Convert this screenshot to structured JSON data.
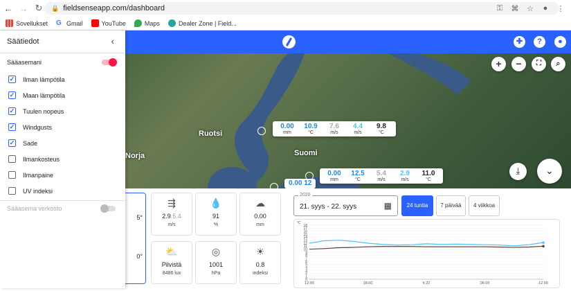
{
  "browser": {
    "url": "fieldsenseapp.com/dashboard",
    "bookmarks": [
      "Sovellukset",
      "Gmail",
      "YouTube",
      "Maps",
      "Dealer Zone | Field..."
    ]
  },
  "colors": {
    "accent": "#2962ff",
    "toggle_on": "#ff1744",
    "temp": "#4fc3f7"
  },
  "sidebar": {
    "title": "Säätiedot",
    "stations_label": "Sääasemani",
    "stations_toggle": true,
    "items": [
      {
        "label": "Ilman lämpötila",
        "checked": true
      },
      {
        "label": "Maan lämpötila",
        "checked": true
      },
      {
        "label": "Tuulen nopeus",
        "checked": true
      },
      {
        "label": "Windgusts",
        "checked": true
      },
      {
        "label": "Sade",
        "checked": true
      },
      {
        "label": "Ilmankosteus",
        "checked": false
      },
      {
        "label": "Ilmanpaine",
        "checked": false
      },
      {
        "label": "UV indeksi",
        "checked": false
      }
    ],
    "network_label": "Sääasema verkosto",
    "network_toggle": false
  },
  "map": {
    "labels": [
      "Ruotsi",
      "Suomi",
      "Norja"
    ],
    "popups": [
      {
        "values": [
          {
            "v": "0.00",
            "u": "mm",
            "c": "#1e88e5"
          },
          {
            "v": "10.9",
            "u": "°C",
            "c": "#1e88e5"
          },
          {
            "v": "7.6",
            "u": "m/s",
            "c": "#aaaaaa"
          },
          {
            "v": "4.4",
            "u": "m/s",
            "c": "#4fc3f7"
          },
          {
            "v": "9.8",
            "u": "°C",
            "c": "#222222"
          }
        ]
      },
      {
        "values": [
          {
            "v": "0.00",
            "u": "mm",
            "c": "#1e88e5"
          },
          {
            "v": "12.5",
            "u": "°C",
            "c": "#1e88e5"
          },
          {
            "v": "5.4",
            "u": "m/s",
            "c": "#aaaaaa"
          },
          {
            "v": "2.9",
            "u": "m/s",
            "c": "#4fc3f7"
          },
          {
            "v": "11.0",
            "u": "°C",
            "c": "#222222"
          }
        ]
      }
    ],
    "partial_popup": "0.00  12"
  },
  "tiles_row1": [
    {
      "icon": "wind-icon",
      "glyph": "⇶",
      "value": "2.9",
      "alt": "5.4",
      "unit": "m/s"
    },
    {
      "icon": "humidity-icon",
      "glyph": "💧",
      "value": "91",
      "alt": "",
      "unit": "%"
    },
    {
      "icon": "rain-cloud-icon",
      "glyph": "☁",
      "value": "0.00",
      "alt": "",
      "unit": "mm"
    }
  ],
  "tiles_row2": [
    {
      "icon": "partly-cloudy-icon",
      "glyph": "⛅",
      "value": "Pilvistä",
      "alt": "",
      "unit": "8486 lux"
    },
    {
      "icon": "pressure-gauge-icon",
      "glyph": "◎",
      "value": "1001",
      "alt": "",
      "unit": "hPa"
    },
    {
      "icon": "sun-icon",
      "glyph": "☀",
      "value": "0.8",
      "alt": "",
      "unit": "indeksi"
    }
  ],
  "partial_tile": {
    "t1": "5°",
    "t2": "0°"
  },
  "range": {
    "year": "2020",
    "dates": "21. syys - 22. syys",
    "buttons": [
      "24 tuntia",
      "7 päivää",
      "4 viikkoa"
    ],
    "active": 0
  },
  "chart_data": {
    "type": "line",
    "ylabel": "°C",
    "ylim": [
      0,
      18
    ],
    "yticks": [
      0,
      1,
      2,
      3,
      4,
      5,
      6,
      7,
      8,
      9,
      10,
      11,
      12,
      13,
      14,
      15,
      16,
      17,
      18
    ],
    "xticks": [
      "12:00",
      "18:00",
      "ti 22",
      "06:00",
      "12:00"
    ],
    "series": [
      {
        "color": "#4fc3f7",
        "values": [
          12.0,
          12.8,
          13.0,
          12.6,
          12.0,
          11.6,
          11.4,
          11.5,
          11.8,
          11.6,
          11.7,
          11.6,
          11.5,
          11.4,
          11.1,
          11.5,
          12.2
        ]
      },
      {
        "color": "#5d4037",
        "values": [
          10.0,
          10.2,
          10.5,
          10.6,
          10.8,
          10.9,
          10.9,
          10.9,
          10.8,
          10.8,
          10.8,
          10.8,
          10.8,
          10.7,
          10.6,
          10.7,
          11.0
        ]
      }
    ]
  }
}
